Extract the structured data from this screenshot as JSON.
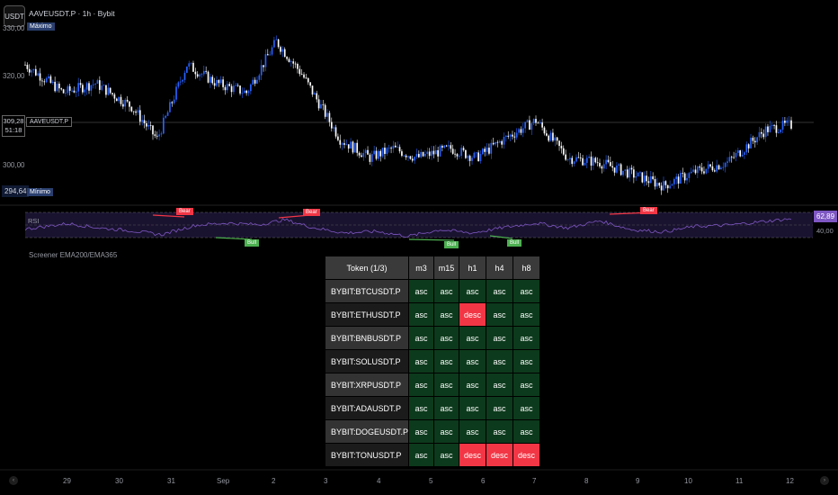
{
  "header": {
    "currency_button": "USDT",
    "symbol_title": "AAVEUSDT.P · 1h · Bybit",
    "max_label": "Máximo",
    "min_label": "Mínimo"
  },
  "price_axis": {
    "top_label": "330,00",
    "labels": [
      "320,00",
      "300,00"
    ],
    "current_price": "309,28",
    "countdown": "51:18",
    "symbol_tag": "AAVEUSDT.P",
    "min_price": "294,64"
  },
  "rsi": {
    "name": "RSI",
    "value": "62,89",
    "level": "40,00",
    "signals": [
      {
        "text": "Bear",
        "kind": "bear"
      },
      {
        "text": "Bear",
        "kind": "bear"
      },
      {
        "text": "Bear",
        "kind": "bear"
      },
      {
        "text": "Bull",
        "kind": "bull"
      },
      {
        "text": "Bull",
        "kind": "bull"
      },
      {
        "text": "Bull",
        "kind": "bull"
      }
    ]
  },
  "screener": {
    "title": "Screener EMA200/EMA365",
    "headers": [
      "Token (1/3)",
      "m3",
      "m15",
      "h1",
      "h4",
      "h8"
    ],
    "rows": [
      {
        "token": "BYBIT:BTCUSDT.P",
        "cells": [
          "asc",
          "asc",
          "asc",
          "asc",
          "asc"
        ]
      },
      {
        "token": "BYBIT:ETHUSDT.P",
        "cells": [
          "asc",
          "asc",
          "desc",
          "asc",
          "asc"
        ]
      },
      {
        "token": "BYBIT:BNBUSDT.P",
        "cells": [
          "asc",
          "asc",
          "asc",
          "asc",
          "asc"
        ]
      },
      {
        "token": "BYBIT:SOLUSDT.P",
        "cells": [
          "asc",
          "asc",
          "asc",
          "asc",
          "asc"
        ]
      },
      {
        "token": "BYBIT:XRPUSDT.P",
        "cells": [
          "asc",
          "asc",
          "asc",
          "asc",
          "asc"
        ]
      },
      {
        "token": "BYBIT:ADAUSDT.P",
        "cells": [
          "asc",
          "asc",
          "asc",
          "asc",
          "asc"
        ]
      },
      {
        "token": "BYBIT:DOGEUSDT.P",
        "cells": [
          "asc",
          "asc",
          "asc",
          "asc",
          "asc"
        ]
      },
      {
        "token": "BYBIT:TONUSDT.P",
        "cells": [
          "asc",
          "asc",
          "desc",
          "desc",
          "desc"
        ]
      }
    ]
  },
  "time_axis": {
    "labels": [
      "29",
      "30",
      "31",
      "Sep",
      "2",
      "3",
      "4",
      "5",
      "6",
      "7",
      "8",
      "9",
      "10",
      "11",
      "12"
    ]
  },
  "colors": {
    "bull_candle": "#2962ff",
    "bear_candle": "#ffffff",
    "asc": "#0c3a1c",
    "desc": "#f23645",
    "rsi_line": "#7e57c2"
  },
  "chart_data": {
    "type": "candlestick",
    "symbol": "AAVEUSDT.P",
    "timeframe": "1h",
    "exchange": "Bybit",
    "ylim": [
      292,
      333
    ],
    "current": 309.28,
    "maximum": 331,
    "minimum": 294.64,
    "key_points": [
      [
        0,
        322
      ],
      [
        18,
        316
      ],
      [
        33,
        318
      ],
      [
        50,
        313
      ],
      [
        62,
        306
      ],
      [
        76,
        322
      ],
      [
        90,
        318
      ],
      [
        104,
        316
      ],
      [
        118,
        327
      ],
      [
        130,
        320
      ],
      [
        148,
        306
      ],
      [
        162,
        302
      ],
      [
        173,
        304
      ],
      [
        184,
        302
      ],
      [
        200,
        304
      ],
      [
        212,
        302
      ],
      [
        225,
        306
      ],
      [
        240,
        310
      ],
      [
        255,
        302
      ],
      [
        270,
        301
      ],
      [
        288,
        298
      ],
      [
        300,
        296
      ],
      [
        315,
        299
      ],
      [
        330,
        301
      ],
      [
        348,
        308
      ],
      [
        358,
        309
      ]
    ],
    "x_range": [
      0,
      360
    ],
    "rsi_key_points": [
      [
        0,
        45
      ],
      [
        20,
        55
      ],
      [
        35,
        47
      ],
      [
        50,
        42
      ],
      [
        64,
        35
      ],
      [
        80,
        52
      ],
      [
        95,
        56
      ],
      [
        110,
        53
      ],
      [
        122,
        62
      ],
      [
        135,
        48
      ],
      [
        150,
        38
      ],
      [
        165,
        41
      ],
      [
        180,
        32
      ],
      [
        195,
        44
      ],
      [
        210,
        38
      ],
      [
        225,
        48
      ],
      [
        240,
        56
      ],
      [
        255,
        47
      ],
      [
        270,
        60
      ],
      [
        285,
        44
      ],
      [
        300,
        40
      ],
      [
        315,
        50
      ],
      [
        330,
        52
      ],
      [
        345,
        58
      ],
      [
        358,
        63
      ]
    ]
  }
}
